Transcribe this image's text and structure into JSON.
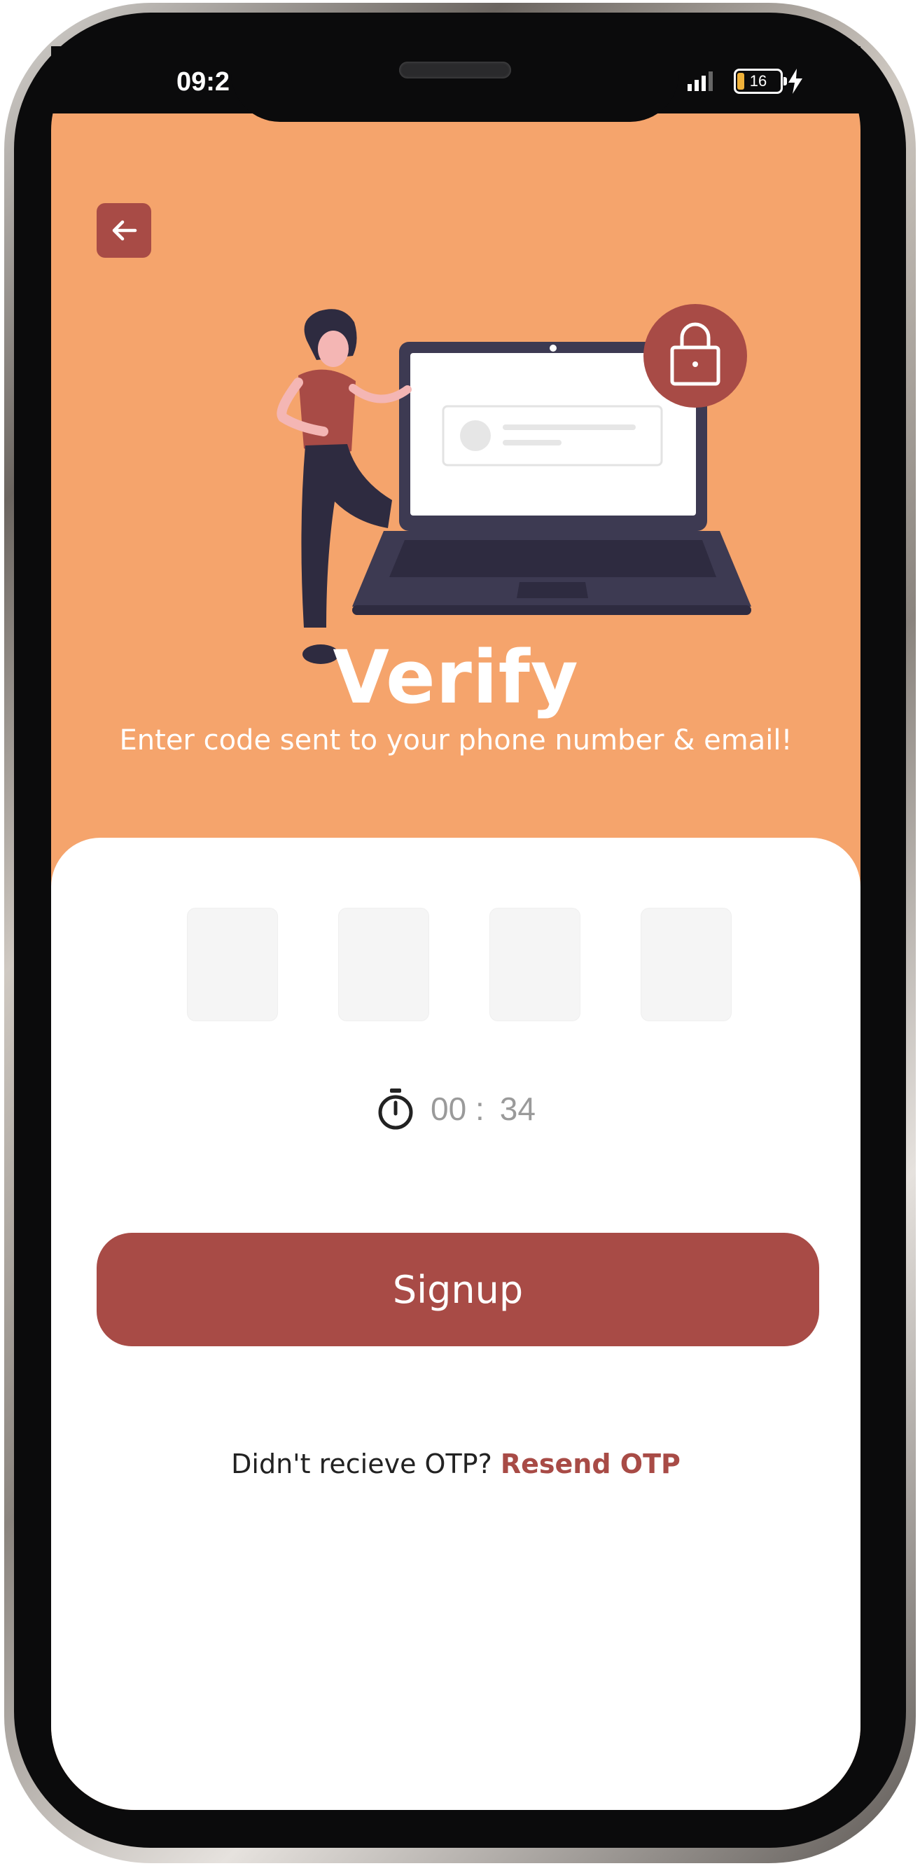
{
  "status_bar": {
    "time": "09:2",
    "battery_level": "16"
  },
  "header": {
    "title": "Verify",
    "subtitle": "Enter code sent to your phone number & email!"
  },
  "otp": {
    "digits": [
      "",
      "",
      "",
      ""
    ]
  },
  "timer": {
    "minutes": "00 :",
    "seconds": "34"
  },
  "actions": {
    "signup_label": "Signup",
    "resend_prompt": "Didn't recieve OTP?",
    "resend_label": "Resend OTP"
  },
  "colors": {
    "background": "#f5a46c",
    "accent": "#a84b46",
    "card": "#ffffff",
    "input_fill": "#f5f5f5"
  }
}
